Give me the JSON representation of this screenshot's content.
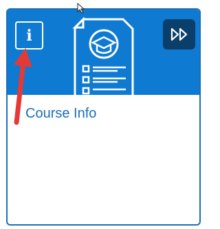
{
  "card": {
    "info_icon": "info-icon",
    "info_glyph": "i",
    "expand_icon": "double-chevron-right-icon",
    "illustration_icon": "course-document-graduation-cap-icon",
    "title": "Course Info"
  },
  "colors": {
    "banner": "#0f7ad1",
    "expand_button": "#0b3f6b",
    "card_border": "#1b6fb5",
    "title_text": "#1b6fb5",
    "annotation_arrow": "#e53935"
  }
}
